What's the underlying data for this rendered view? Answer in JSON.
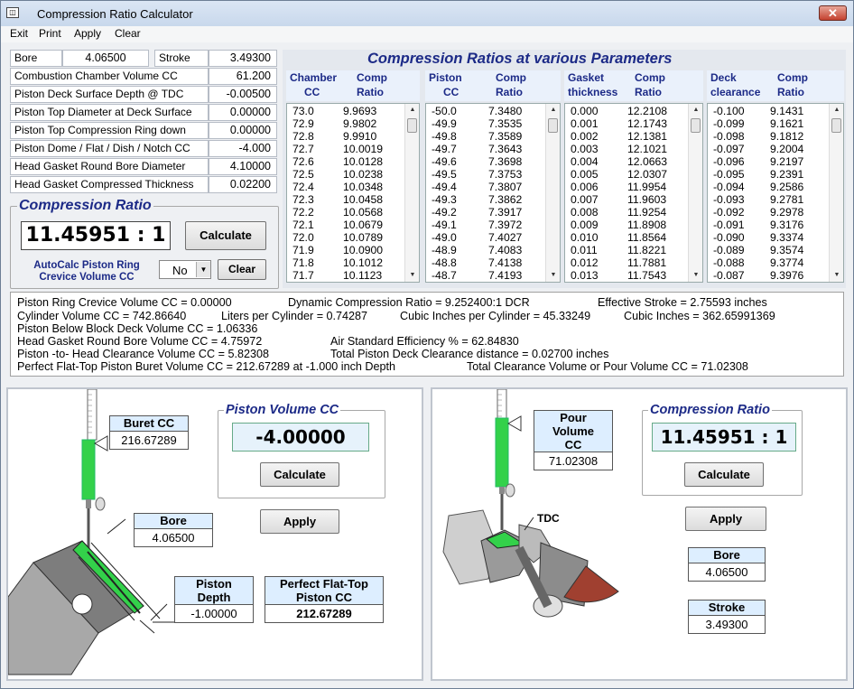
{
  "window": {
    "title": "Compression Ratio Calculator",
    "close": "✕",
    "icon": "app-icon"
  },
  "menu": [
    "Exit",
    "Print",
    "Apply",
    "Clear"
  ],
  "inputs": {
    "bore_label": "Bore",
    "bore_value": "4.06500",
    "stroke_label": "Stroke",
    "stroke_value": "3.49300",
    "rows": [
      {
        "label": "Combustion Chamber Volume CC",
        "value": "61.200"
      },
      {
        "label": "Piston Deck Surface Depth  @  TDC",
        "value": "-0.00500"
      },
      {
        "label": "Piston Top Diameter at Deck Surface",
        "value": "0.00000"
      },
      {
        "label": "Piston Top Compression Ring down",
        "value": "0.00000"
      },
      {
        "label": "Piston Dome / Flat / Dish / Notch CC",
        "value": "-4.000"
      },
      {
        "label": "Head Gasket Round Bore Diameter",
        "value": "4.10000"
      },
      {
        "label": "Head Gasket Compressed Thickness",
        "value": "0.02200"
      }
    ]
  },
  "cr_box": {
    "title": "Compression Ratio",
    "value": "11.45951 : 1",
    "calculate": "Calculate",
    "autocalc_label": "AutoCalc Piston Ring Crevice Volume CC",
    "autocalc_line1": "AutoCalc Piston Ring",
    "autocalc_line2": "Crevice Volume CC",
    "select_value": "No",
    "clear": "Clear"
  },
  "tables_title": "Compression Ratios  at  various  Parameters",
  "tables": [
    {
      "h1a": "Chamber",
      "h1b": "CC",
      "h2a": "Comp",
      "h2b": "Ratio",
      "rows": [
        [
          "73.0",
          "9.9693"
        ],
        [
          "72.9",
          "9.9802"
        ],
        [
          "72.8",
          "9.9910"
        ],
        [
          "72.7",
          "10.0019"
        ],
        [
          "72.6",
          "10.0128"
        ],
        [
          "72.5",
          "10.0238"
        ],
        [
          "72.4",
          "10.0348"
        ],
        [
          "72.3",
          "10.0458"
        ],
        [
          "72.2",
          "10.0568"
        ],
        [
          "72.1",
          "10.0679"
        ],
        [
          "72.0",
          "10.0789"
        ],
        [
          "71.9",
          "10.0900"
        ],
        [
          "71.8",
          "10.1012"
        ],
        [
          "71.7",
          "10.1123"
        ]
      ]
    },
    {
      "h1a": "Piston",
      "h1b": "CC",
      "h2a": "Comp",
      "h2b": "Ratio",
      "rows": [
        [
          "-50.0",
          "7.3480"
        ],
        [
          "-49.9",
          "7.3535"
        ],
        [
          "-49.8",
          "7.3589"
        ],
        [
          "-49.7",
          "7.3643"
        ],
        [
          "-49.6",
          "7.3698"
        ],
        [
          "-49.5",
          "7.3753"
        ],
        [
          "-49.4",
          "7.3807"
        ],
        [
          "-49.3",
          "7.3862"
        ],
        [
          "-49.2",
          "7.3917"
        ],
        [
          "-49.1",
          "7.3972"
        ],
        [
          "-49.0",
          "7.4027"
        ],
        [
          "-48.9",
          "7.4083"
        ],
        [
          "-48.8",
          "7.4138"
        ],
        [
          "-48.7",
          "7.4193"
        ]
      ]
    },
    {
      "h1a": "Gasket",
      "h1b": "thickness",
      "h2a": "Comp",
      "h2b": "Ratio",
      "rows": [
        [
          "0.000",
          "12.2108"
        ],
        [
          "0.001",
          "12.1743"
        ],
        [
          "0.002",
          "12.1381"
        ],
        [
          "0.003",
          "12.1021"
        ],
        [
          "0.004",
          "12.0663"
        ],
        [
          "0.005",
          "12.0307"
        ],
        [
          "0.006",
          "11.9954"
        ],
        [
          "0.007",
          "11.9603"
        ],
        [
          "0.008",
          "11.9254"
        ],
        [
          "0.009",
          "11.8908"
        ],
        [
          "0.010",
          "11.8564"
        ],
        [
          "0.011",
          "11.8221"
        ],
        [
          "0.012",
          "11.7881"
        ],
        [
          "0.013",
          "11.7543"
        ]
      ]
    },
    {
      "h1a": "Deck",
      "h1b": "clearance",
      "h2a": "Comp",
      "h2b": "Ratio",
      "rows": [
        [
          "-0.100",
          "9.1431"
        ],
        [
          "-0.099",
          "9.1621"
        ],
        [
          "-0.098",
          "9.1812"
        ],
        [
          "-0.097",
          "9.2004"
        ],
        [
          "-0.096",
          "9.2197"
        ],
        [
          "-0.095",
          "9.2391"
        ],
        [
          "-0.094",
          "9.2586"
        ],
        [
          "-0.093",
          "9.2781"
        ],
        [
          "-0.092",
          "9.2978"
        ],
        [
          "-0.091",
          "9.3176"
        ],
        [
          "-0.090",
          "9.3374"
        ],
        [
          "-0.089",
          "9.3574"
        ],
        [
          "-0.088",
          "9.3774"
        ],
        [
          "-0.087",
          "9.3976"
        ]
      ]
    }
  ],
  "info": {
    "l1a": "Piston Ring Crevice Volume CC = 0.00000",
    "l1b": "Dynamic Compression Ratio    = 9.252400:1  DCR",
    "l1c": "Effective Stroke = 2.75593 inches",
    "l2a": "Cylinder Volume CC = 742.86640",
    "l2b": "Liters per Cylinder = 0.74287",
    "l2c": "Cubic Inches per Cylinder = 45.33249",
    "l2d": "Cubic Inches = 362.65991369",
    "l3a": "Piston Below Block Deck Volume CC = 1.06336",
    "l4a": "Head Gasket Round Bore Volume CC = 4.75972",
    "l4b": "Air Standard Efficiency % = 62.84830",
    "l5a": "Piston -to- Head Clearance Volume CC = 5.82308",
    "l5b": "Total Piston Deck Clearance distance = 0.02700 inches",
    "l6a": "Perfect Flat-Top Piston Buret Volume CC = 212.67289  at  -1.000 inch Depth",
    "l6b": "Total Clearance Volume  or  Pour Volume CC = 71.02308"
  },
  "left_panel": {
    "buret_head": "Buret CC",
    "buret_value": "216.67289",
    "bore_head": "Bore",
    "bore_value": "4.06500",
    "depth_head1": "Piston",
    "depth_head2": "Depth",
    "depth_value": "-1.00000",
    "flat_head1": "Perfect  Flat-Top",
    "flat_head2": "Piston  CC",
    "flat_value": "212.67289",
    "pv_title": "Piston Volume CC",
    "pv_value": "-4.00000",
    "calculate": "Calculate",
    "apply": "Apply"
  },
  "right_panel": {
    "pour_head1": "Pour",
    "pour_head2": "Volume",
    "pour_head3": "CC",
    "pour_value": "71.02308",
    "tdc": "TDC",
    "cr_title": "Compression Ratio",
    "cr_value": "11.45951 : 1",
    "calculate": "Calculate",
    "apply": "Apply",
    "bore_head": "Bore",
    "bore_value": "4.06500",
    "stroke_head": "Stroke",
    "stroke_value": "3.49300"
  },
  "colors": {
    "accent": "#1c2a87",
    "green": "#33d14a",
    "titlebar": "#c8d8ec"
  }
}
